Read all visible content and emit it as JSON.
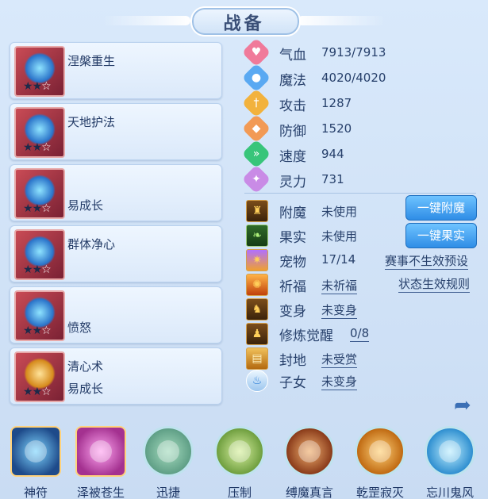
{
  "title": "战备",
  "cards": [
    {
      "line1": "涅槃重生",
      "line2": "",
      "stars": 2
    },
    {
      "line1": "天地护法",
      "line2": "",
      "stars": 2
    },
    {
      "line1": "",
      "line2": "易成长",
      "stars": 2
    },
    {
      "line1": "群体净心",
      "line2": "",
      "stars": 2
    },
    {
      "line1": "",
      "line2": "愤怒",
      "stars": 2
    },
    {
      "line1": "清心术",
      "line2": "易成长",
      "stars": 2
    }
  ],
  "stats": [
    {
      "icon": "heart-icon",
      "label": "气血",
      "value": "7913/7913",
      "color": "#f07a9a"
    },
    {
      "icon": "mana-icon",
      "label": "魔法",
      "value": "4020/4020",
      "color": "#5aa9f2"
    },
    {
      "icon": "attack-icon",
      "label": "攻击",
      "value": "1287",
      "color": "#f2b23d"
    },
    {
      "icon": "defense-icon",
      "label": "防御",
      "value": "1520",
      "color": "#f29a55"
    },
    {
      "icon": "speed-icon",
      "label": "速度",
      "value": "944",
      "color": "#38c57a"
    },
    {
      "icon": "spirit-icon",
      "label": "灵力",
      "value": "731",
      "color": "#c98be6"
    }
  ],
  "buffs": [
    {
      "icon": "enchant-icon",
      "label": "附魔",
      "value": "未使用"
    },
    {
      "icon": "fruit-icon",
      "label": "果实",
      "value": "未使用"
    },
    {
      "icon": "pet-icon",
      "label": "宠物",
      "value": "17/14"
    },
    {
      "icon": "blessing-icon",
      "label": "祈福",
      "value": "未祈福"
    },
    {
      "icon": "transform-icon",
      "label": "变身",
      "value": "未变身"
    },
    {
      "icon": "cultivation-icon",
      "label": "修炼觉醒",
      "value": "0/8"
    },
    {
      "icon": "territory-icon",
      "label": "封地",
      "value": "未受赏"
    },
    {
      "icon": "child-icon",
      "label": "子女",
      "value": "未变身"
    }
  ],
  "buttons": {
    "enchant": "一键附魔",
    "fruit": "一键果实"
  },
  "links": {
    "tournament": "赛事不生效预设",
    "status_rules": "状态生效规则"
  },
  "skills": [
    {
      "label": "神符",
      "icon": "talisman-icon"
    },
    {
      "label": "泽被苍生",
      "icon": "blessing-hand-icon"
    },
    {
      "label": "迅捷",
      "icon": "swift-icon"
    },
    {
      "label": "压制",
      "icon": "suppress-icon"
    },
    {
      "label": "缚魔真言",
      "icon": "bind-demon-icon"
    },
    {
      "label": "乾罡寂灭",
      "icon": "annihilation-icon"
    },
    {
      "label": "忘川鬼风",
      "icon": "ghost-wind-icon"
    }
  ]
}
